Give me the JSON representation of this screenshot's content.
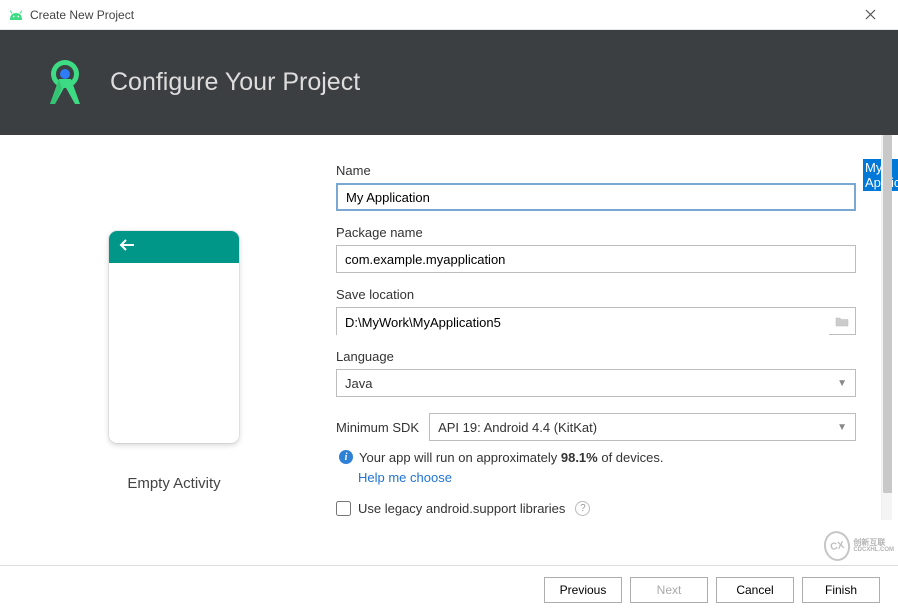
{
  "window": {
    "title": "Create New Project"
  },
  "header": {
    "title": "Configure Your Project"
  },
  "preview": {
    "label": "Empty Activity"
  },
  "form": {
    "name": {
      "label": "Name",
      "value": "My Application"
    },
    "package": {
      "label": "Package name",
      "value": "com.example.myapplication"
    },
    "location": {
      "label": "Save location",
      "value": "D:\\MyWork\\MyApplication5"
    },
    "language": {
      "label": "Language",
      "value": "Java"
    },
    "sdk": {
      "label": "Minimum SDK",
      "value": "API 19: Android 4.4 (KitKat)"
    },
    "info_prefix": "Your app will run on approximately ",
    "info_percent": "98.1%",
    "info_suffix": " of devices.",
    "help_link": "Help me choose",
    "legacy_checkbox": "Use legacy android.support libraries"
  },
  "footer": {
    "previous": "Previous",
    "next": "Next",
    "cancel": "Cancel",
    "finish": "Finish"
  },
  "watermark": {
    "line1": "创新互联",
    "line2": "CDCXHL.COM"
  }
}
